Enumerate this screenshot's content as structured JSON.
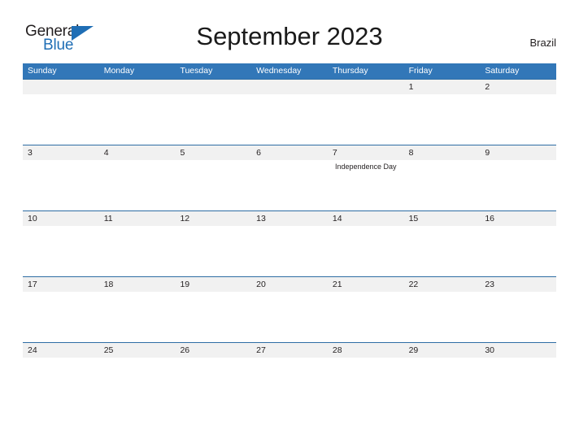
{
  "brand": {
    "name_part1": "General",
    "name_part2": "Blue",
    "triangle_color": "#1f6eb5",
    "text_color": "#231f20"
  },
  "header": {
    "title": "September 2023",
    "country": "Brazil",
    "weekday_header_bg": "#3277b8",
    "weekday_header_text_color": "#ffffff",
    "date_band_bg": "#f1f1f1",
    "row_divider_color": "#2e6da4"
  },
  "calendar": {
    "month": "September",
    "year": "2023",
    "weekdays": [
      "Sunday",
      "Monday",
      "Tuesday",
      "Wednesday",
      "Thursday",
      "Friday",
      "Saturday"
    ],
    "weeks": [
      {
        "days": [
          {
            "date": "",
            "event": ""
          },
          {
            "date": "",
            "event": ""
          },
          {
            "date": "",
            "event": ""
          },
          {
            "date": "",
            "event": ""
          },
          {
            "date": "",
            "event": ""
          },
          {
            "date": "1",
            "event": ""
          },
          {
            "date": "2",
            "event": ""
          }
        ]
      },
      {
        "days": [
          {
            "date": "3",
            "event": ""
          },
          {
            "date": "4",
            "event": ""
          },
          {
            "date": "5",
            "event": ""
          },
          {
            "date": "6",
            "event": ""
          },
          {
            "date": "7",
            "event": "Independence Day"
          },
          {
            "date": "8",
            "event": ""
          },
          {
            "date": "9",
            "event": ""
          }
        ]
      },
      {
        "days": [
          {
            "date": "10",
            "event": ""
          },
          {
            "date": "11",
            "event": ""
          },
          {
            "date": "12",
            "event": ""
          },
          {
            "date": "13",
            "event": ""
          },
          {
            "date": "14",
            "event": ""
          },
          {
            "date": "15",
            "event": ""
          },
          {
            "date": "16",
            "event": ""
          }
        ]
      },
      {
        "days": [
          {
            "date": "17",
            "event": ""
          },
          {
            "date": "18",
            "event": ""
          },
          {
            "date": "19",
            "event": ""
          },
          {
            "date": "20",
            "event": ""
          },
          {
            "date": "21",
            "event": ""
          },
          {
            "date": "22",
            "event": ""
          },
          {
            "date": "23",
            "event": ""
          }
        ]
      },
      {
        "days": [
          {
            "date": "24",
            "event": ""
          },
          {
            "date": "25",
            "event": ""
          },
          {
            "date": "26",
            "event": ""
          },
          {
            "date": "27",
            "event": ""
          },
          {
            "date": "28",
            "event": ""
          },
          {
            "date": "29",
            "event": ""
          },
          {
            "date": "30",
            "event": ""
          }
        ]
      }
    ]
  }
}
